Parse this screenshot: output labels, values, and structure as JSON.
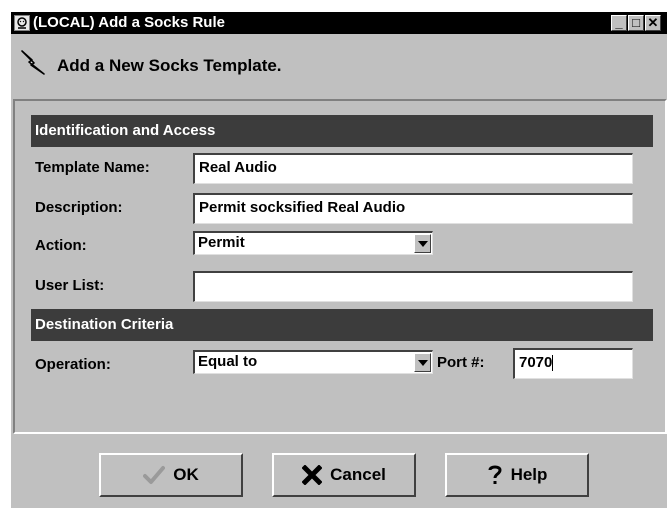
{
  "window": {
    "title": "(LOCAL) Add a Socks Rule",
    "controls": {
      "minimize": "_",
      "maximize": "□",
      "close": "✕"
    }
  },
  "header": {
    "icon": "lightning-bolt-icon",
    "text": "Add a New Socks Template."
  },
  "identification": {
    "title": "Identification and Access",
    "template_name_label": "Template Name:",
    "template_name_value": "Real Audio",
    "description_label": "Description:",
    "description_value": "Permit socksified Real Audio",
    "action_label": "Action:",
    "action_value": "Permit",
    "user_list_label": "User List:",
    "user_list_value": ""
  },
  "destination": {
    "title": "Destination Criteria",
    "operation_label": "Operation:",
    "operation_value": "Equal to",
    "port_label": "Port #:",
    "port_value": "7070"
  },
  "buttons": {
    "ok": "OK",
    "cancel": "Cancel",
    "help": "Help"
  },
  "colors": {
    "window_bg": "#c0c0c0",
    "titlebar_bg": "#000000",
    "section_bg": "#3c3c3c",
    "ok_icon": "#a0a0a0"
  }
}
